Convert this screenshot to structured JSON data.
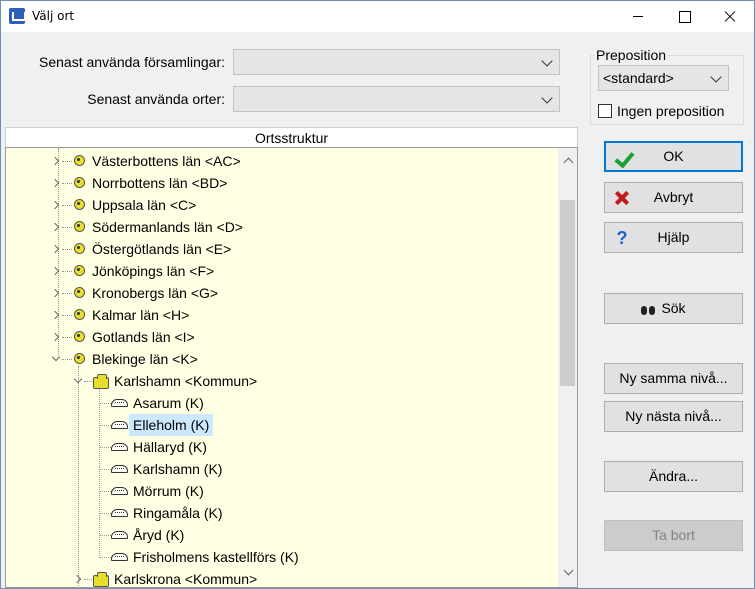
{
  "window": {
    "title": "Välj ort"
  },
  "form": {
    "recent_parishes_label": "Senast använda församlingar:",
    "recent_parishes_value": "",
    "recent_places_label": "Senast använda orter:",
    "recent_places_value": ""
  },
  "preposition": {
    "group_label": "Preposition",
    "selected": "<standard>",
    "none_label": "Ingen preposition",
    "none_checked": false
  },
  "tree": {
    "header": "Ortsstruktur",
    "counties": [
      "Västerbottens län <AC>",
      "Norrbottens län <BD>",
      "Uppsala län <C>",
      "Södermanlands län <D>",
      "Östergötlands län <E>",
      "Jönköpings län <F>",
      "Kronobergs län <G>",
      "Kalmar län <H>",
      "Gotlands län <I>",
      "Blekinge län <K>"
    ],
    "kommun_open": "Karlshamn <Kommun>",
    "places": [
      "Asarum (K)",
      "Elleholm (K)",
      "Hällaryd (K)",
      "Karlshamn (K)",
      "Mörrum (K)",
      "Ringamåla (K)",
      "Åryd (K)",
      "Frisholmens kastellförs (K)"
    ],
    "kommun_next": "Karlskrona <Kommun>"
  },
  "buttons": {
    "ok": "OK",
    "cancel": "Avbryt",
    "help": "Hjälp",
    "search": "Sök",
    "new_same": "Ny samma nivå...",
    "new_next": "Ny nästa nivå...",
    "edit": "Ändra...",
    "delete": "Ta bort"
  }
}
